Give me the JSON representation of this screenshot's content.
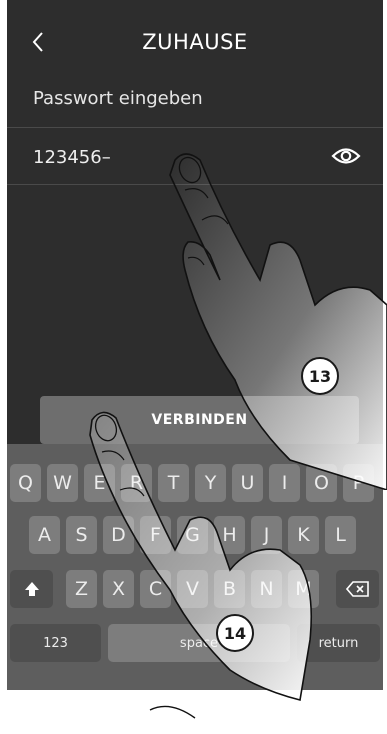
{
  "header": {
    "title": "ZUHAUSE",
    "back_icon": "chevron-left-icon"
  },
  "password": {
    "label": "Passwort eingeben",
    "value": "123456–",
    "toggle_icon": "eye-icon"
  },
  "connect_button": {
    "label": "VERBINDEN"
  },
  "keyboard": {
    "row1": [
      "Q",
      "W",
      "E",
      "R",
      "T",
      "Y",
      "U",
      "I",
      "O",
      "P"
    ],
    "row2": [
      "A",
      "S",
      "D",
      "F",
      "G",
      "H",
      "J",
      "K",
      "L"
    ],
    "row3": [
      "Z",
      "X",
      "C",
      "V",
      "B",
      "N",
      "M"
    ],
    "shift_icon": "shift-arrow-icon",
    "backspace_icon": "backspace-icon",
    "numbers_label": "123",
    "space_label": "space",
    "return_label": "return"
  },
  "annotations": {
    "callout_1": "13",
    "callout_2": "14"
  },
  "colors": {
    "background": "#2d2d2d",
    "keyboard": "#5e5e5e",
    "key": "#7d7d7d",
    "button": "#6e6e6e"
  }
}
